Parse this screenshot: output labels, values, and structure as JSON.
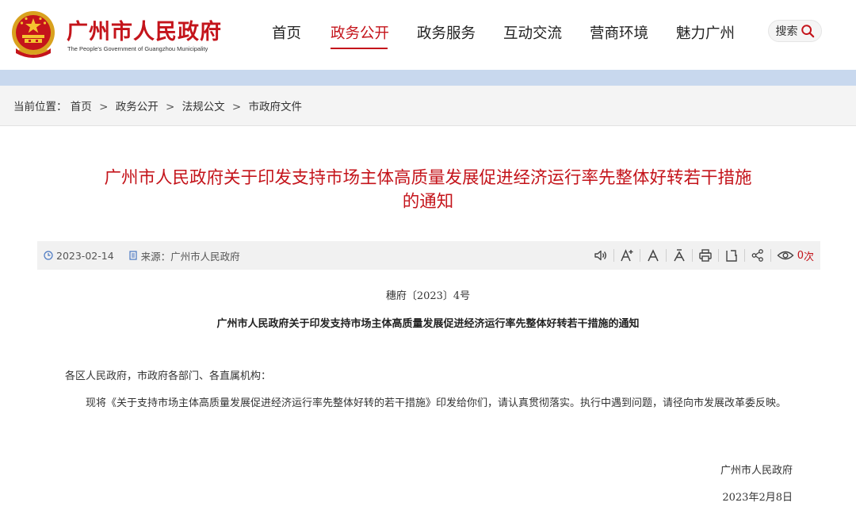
{
  "header": {
    "site_name": "广州市人民政府",
    "site_name_en": "The People's Government of Guangzhou Municipality",
    "nav": [
      {
        "label": "首页"
      },
      {
        "label": "政务公开"
      },
      {
        "label": "政务服务"
      },
      {
        "label": "互动交流"
      },
      {
        "label": "营商环境"
      },
      {
        "label": "魅力广州"
      }
    ],
    "active_nav": "政务公开",
    "search_label": "搜索",
    "brand_color": "#c4141b"
  },
  "breadcrumb": {
    "prefix": "当前位置：",
    "items": [
      "首页",
      "政务公开",
      "法规公文",
      "市政府文件"
    ],
    "separator": ">"
  },
  "article": {
    "title_line1": "广州市人民政府关于印发支持市场主体高质量发展促进经济运行率先整体好转若干措施",
    "title_line2": "的通知",
    "date": "2023-02-14",
    "source_label": "来源：",
    "source": "广州市人民政府",
    "views": "0",
    "views_suffix": "次",
    "doc_number": "穗府〔2023〕4号",
    "subtitle": "广州市人民政府关于印发支持市场主体高质量发展促进经济运行率先整体好转若干措施的通知",
    "salutation": "各区人民政府，市政府各部门、各直属机构：",
    "body": "现将《关于支持市场主体高质量发展促进经济运行率先整体好转的若干措施》印发给你们，请认真贯彻落实。执行中遇到问题，请径向市发展改革委反映。",
    "signer": "广州市人民政府",
    "sign_date": "2023年2月8日"
  },
  "toolbar": {
    "icons": [
      "speaker-icon",
      "font-increase-icon",
      "font-reset-icon",
      "font-decrease-icon",
      "print-icon",
      "bookmark-icon",
      "share-icon",
      "eye-icon"
    ]
  }
}
